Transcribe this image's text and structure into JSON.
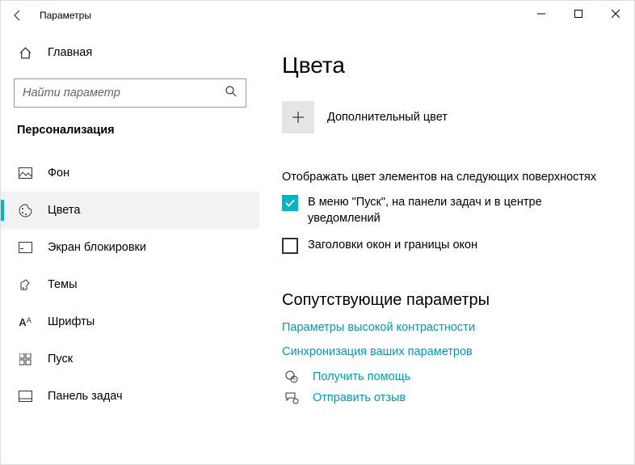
{
  "window": {
    "title": "Параметры"
  },
  "sidebar": {
    "home": "Главная",
    "search_placeholder": "Найти параметр",
    "category": "Персонализация",
    "items": [
      {
        "label": "Фон"
      },
      {
        "label": "Цвета"
      },
      {
        "label": "Экран блокировки"
      },
      {
        "label": "Темы"
      },
      {
        "label": "Шрифты"
      },
      {
        "label": "Пуск"
      },
      {
        "label": "Панель задач"
      }
    ]
  },
  "main": {
    "title": "Цвета",
    "add_color": "Дополнительный цвет",
    "surfaces_label": "Отображать цвет элементов на следующих поверхностях",
    "checkbox1": "В меню \"Пуск\", на панели задач и в центре уведомлений",
    "checkbox2": "Заголовки окон и границы окон",
    "related_heading": "Сопутствующие параметры",
    "link1": "Параметры высокой контрастности",
    "link2": "Синхронизация ваших параметров",
    "help": "Получить помощь",
    "feedback": "Отправить отзыв"
  }
}
